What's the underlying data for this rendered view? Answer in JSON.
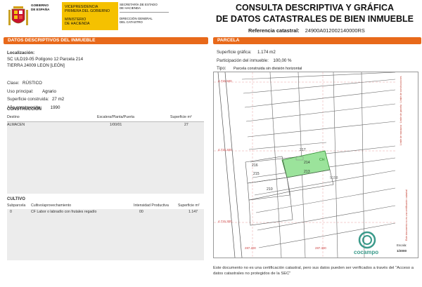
{
  "header": {
    "gobierno": [
      "GOBIERNO",
      "DE ESPAÑA"
    ],
    "vice": [
      "VICEPRESIDENCIA",
      "PRIMERA DEL GOBIERNO"
    ],
    "ministerio": [
      "MINISTERIO",
      "DE HACIENDA"
    ],
    "secretaria": [
      "SECRETARÍA DE ESTADO",
      "DE HACIENDA"
    ],
    "direccion": [
      "DIRECCIÓN GENERAL",
      "DEL CATASTRO"
    ],
    "title_line1": "CONSULTA DESCRIPTIVA Y GRÁFICA",
    "title_line2": "DE DATOS CATASTRALES DE BIEN INMUEBLE",
    "ref_label": "Referencia catastral:",
    "ref_value": "24900A012002140000RS",
    "accent": "#e8691a",
    "yellow": "#f5c100"
  },
  "left": {
    "bar_title": "DATOS DESCRIPTIVOS DEL INMUEBLE",
    "localizacion_label": "Localización:",
    "loc_line1": "SC ULD19-05  Polígono 12 Parcela 214",
    "loc_line2": "TIERRA  24009 LEON [LEÓN]",
    "clase_label": "Clase:",
    "clase_value": "RÚSTICO",
    "uso_label": "Uso principal:",
    "uso_value": "Agrario",
    "sup_label": "Superficie construida:",
    "sup_value": "27 m2",
    "anio_label": "Año construcción:",
    "anio_value": "1990",
    "construccion_title": "CONSTRUCCIÓN",
    "constr_headers": [
      "Destino",
      "Escalera/Planta/Puerta",
      "Superficie m²"
    ],
    "constr_rows": [
      [
        "ALMACEN",
        "1/00/01",
        "27"
      ]
    ],
    "cultivo_title": "CULTIVO",
    "cult_headers": [
      "Subparcela",
      "Cultivo/aprovechamiento",
      "Intensidad Productiva",
      "Superficie m²"
    ],
    "cult_rows": [
      [
        "0",
        "CF Labor o labradío con frutales regadío",
        "00",
        "1.147"
      ]
    ]
  },
  "right": {
    "bar_title": "PARCELA",
    "sup_graf_label": "Superficie gráfica:",
    "sup_graf_value": "1.174 m2",
    "part_label": "Participación del inmueble:",
    "part_value": "100,00 %",
    "tipo_label": "Tipo:",
    "tipo_value": "Parcela construida sin división horizontal",
    "parcel_labels": [
      "217",
      "214",
      "216",
      "215",
      "213",
      "210",
      "5158"
    ],
    "ch_label": "CH",
    "coord_top": "4.715.500",
    "coord_mid": "4.715.400",
    "coord_bot": "4.715.300",
    "coord_x1": "287.200",
    "coord_x2": "287.300",
    "coord_x3": "287.400",
    "escala_label": "Escala:",
    "escala_value": "1/2000",
    "logo_text": "cocampo",
    "legend_items": [
      "Límite de manzana",
      "Límite de parcela",
      "Límite de construcciones",
      "Mobiliario y aceras",
      "Límite zona verde",
      "Hidrografía"
    ],
    "side_text": "Este documento no es una certificación catastral",
    "note": "Este documento no es una certificación catastral, pero sus datos pueden ser verificados a través del \"Acceso a datos catastrales no protegidos de la SEC\""
  }
}
